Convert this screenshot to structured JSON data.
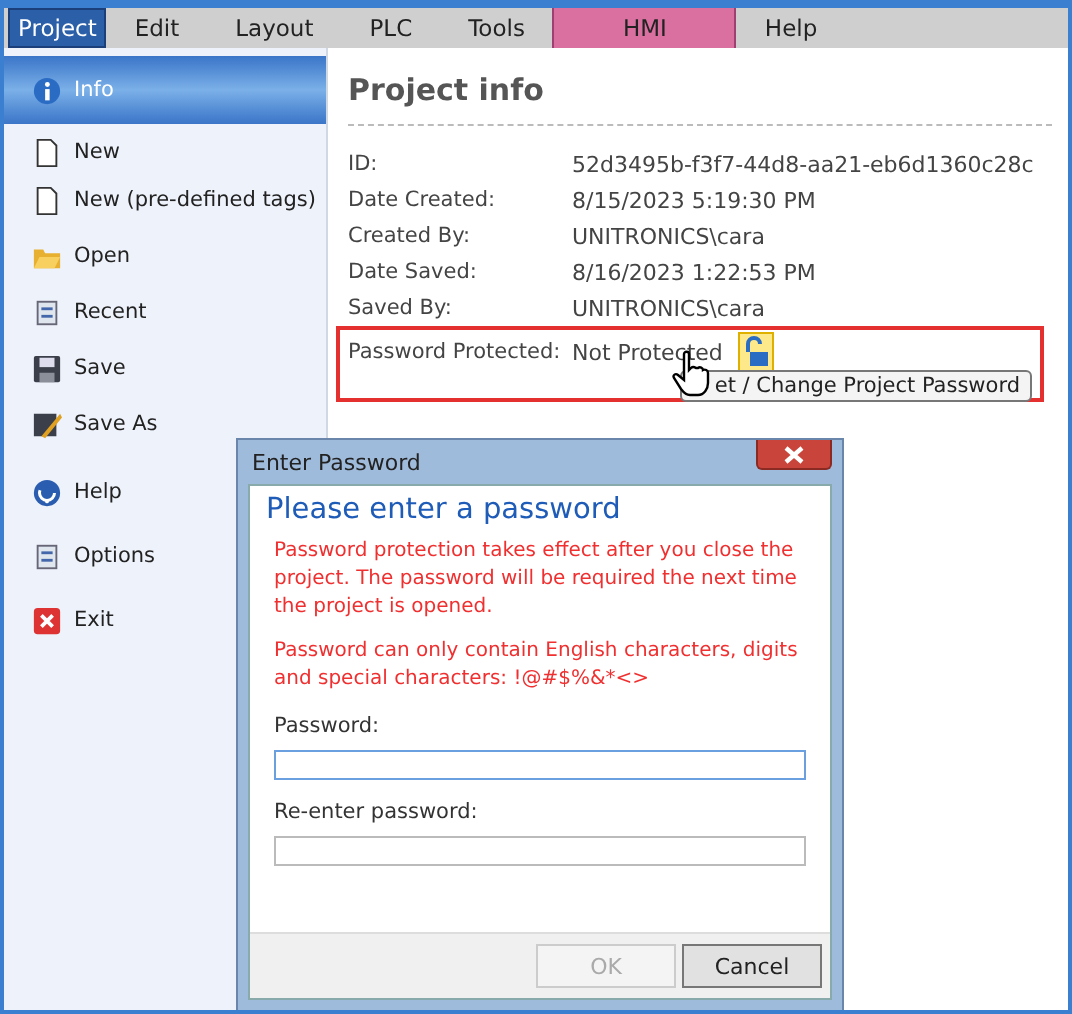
{
  "menu": [
    {
      "label": "Project",
      "selected": true,
      "highlighted": false
    },
    {
      "label": "Edit",
      "selected": false,
      "highlighted": false
    },
    {
      "label": "Layout",
      "selected": false,
      "highlighted": false
    },
    {
      "label": "PLC",
      "selected": false,
      "highlighted": false
    },
    {
      "label": "Tools",
      "selected": false,
      "highlighted": false
    },
    {
      "label": "HMI",
      "selected": false,
      "highlighted": true
    },
    {
      "label": "Help",
      "selected": false,
      "highlighted": false
    }
  ],
  "sidebar": {
    "items": [
      {
        "label": "Info",
        "selected": true
      },
      {
        "label": "New",
        "selected": false
      },
      {
        "label": "New (pre-defined tags)",
        "selected": false
      },
      {
        "label": "Open",
        "selected": false
      },
      {
        "label": "Recent",
        "selected": false
      },
      {
        "label": "Save",
        "selected": false
      },
      {
        "label": "Save As",
        "selected": false
      },
      {
        "label": "Help",
        "selected": false
      },
      {
        "label": "Options",
        "selected": false
      },
      {
        "label": "Exit",
        "selected": false
      }
    ]
  },
  "project_info": {
    "title": "Project info",
    "fields": [
      {
        "label": "ID:",
        "value": "52d3495b-f3f7-44d8-aa21-eb6d1360c28c"
      },
      {
        "label": "Date Created:",
        "value": "8/15/2023 5:19:30 PM"
      },
      {
        "label": "Created By:",
        "value": "UNITRONICS\\cara"
      },
      {
        "label": "Date Saved:",
        "value": "8/16/2023 1:22:53 PM"
      },
      {
        "label": "Saved By:",
        "value": "UNITRONICS\\cara"
      }
    ],
    "password": {
      "label": "Password Protected:",
      "value": "Not Protected",
      "tooltip": "et / Change Project Password"
    }
  },
  "dialog": {
    "title": "Enter Password",
    "heading": "Please enter a password",
    "warnings": [
      "Password protection takes effect after you close the project. The password will be required the next time the project is opened.",
      "Password can only contain English characters, digits and special characters: !@#$%&*<>"
    ],
    "fields": [
      {
        "label": "Password:",
        "focused": true
      },
      {
        "label": "Re-enter password:",
        "focused": false
      }
    ],
    "buttons": [
      {
        "label": "OK",
        "disabled": true
      },
      {
        "label": "Cancel",
        "disabled": false
      }
    ]
  }
}
